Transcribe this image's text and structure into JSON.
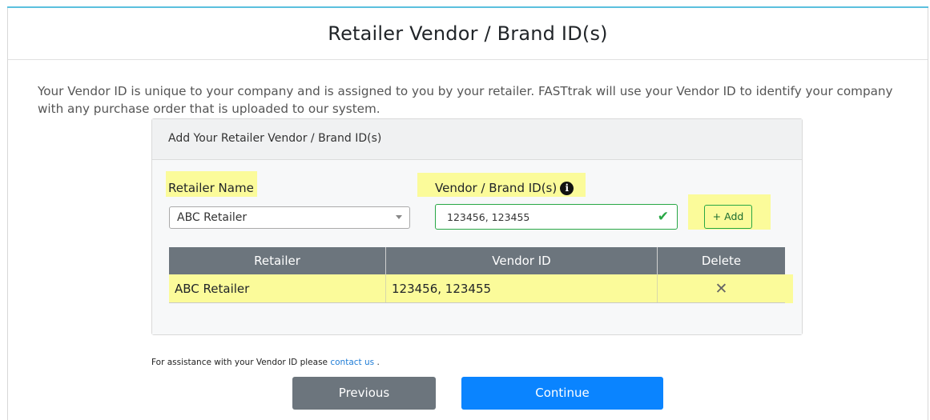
{
  "header": {
    "title": "Retailer Vendor / Brand ID(s)"
  },
  "intro_text": "Your Vendor ID is unique to your company and is assigned to you by your retailer. FASTtrak will use your Vendor ID to identify your company with any purchase order that is uploaded to our system.",
  "card": {
    "title": "Add Your Retailer Vendor / Brand ID(s)",
    "retailer_label": "Retailer Name",
    "retailer_value": "ABC Retailer",
    "vendor_label": "Vendor / Brand ID(s)",
    "vendor_value": "123456, 123455",
    "add_label": "+ Add",
    "info_glyph": "i",
    "check_glyph": "✔",
    "table": {
      "headers": [
        "Retailer",
        "Vendor ID",
        "Delete"
      ],
      "rows": [
        {
          "retailer": "ABC Retailer",
          "vendor_id": "123456, 123455",
          "delete_glyph": "✕"
        }
      ]
    }
  },
  "assist": {
    "prefix": "For assistance with your Vendor ID please ",
    "link": "contact us",
    "suffix": " ."
  },
  "buttons": {
    "previous": "Previous",
    "continue": "Continue"
  },
  "colors": {
    "highlight": "#fbfb9a",
    "accent_top": "#5bc0de",
    "valid_green": "#28a745",
    "table_header": "#6c757d",
    "primary": "#0a84ff",
    "secondary": "#6c757d",
    "link": "#1e7cd6"
  },
  "icons": [
    "info-icon",
    "check-icon",
    "chevron-down-icon",
    "close-icon"
  ]
}
